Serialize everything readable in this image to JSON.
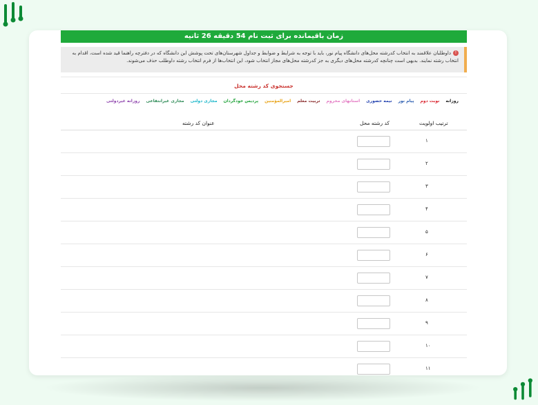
{
  "timer": {
    "text": "زمان باقیمانده برای ثبت نام 54 دقیقه 26 ثانیه"
  },
  "warning": {
    "text": "داوطلبان علاقمند به انتخاب کدرشته محل‌های دانشگاه پیام نور، باید با توجه به شرایط و ضوابط و جداول شهرستان‌های تحت پوشش این دانشگاه که در دفترچه راهنما قید شده است، اقدام به انتخاب رشته نمایند. بدیهی است چنانچه کدرشته محل‌های دیگری به جز کدرشته محل‌های مجاز انتخاب شود، این انتخاب‌ها از فرم انتخاب رشته داوطلب حذف می‌شوند."
  },
  "search": {
    "title": "جستجوی کد رشته محل"
  },
  "filters": [
    {
      "label": "روزانه",
      "color": "#222222"
    },
    {
      "label": "نوبت دوم",
      "color": "#d9232d"
    },
    {
      "label": "پیام نور",
      "color": "#2a5db0"
    },
    {
      "label": "نیمه حضوری",
      "color": "#1f3fae"
    },
    {
      "label": "استانهای محروم",
      "color": "#e377c2"
    },
    {
      "label": "تربیت معلم",
      "color": "#8a2b2b"
    },
    {
      "label": "امیرالمؤمنین",
      "color": "#e8a317"
    },
    {
      "label": "پردیس خودگردان",
      "color": "#21a33a"
    },
    {
      "label": "مجازی دولتی",
      "color": "#17b5c9"
    },
    {
      "label": "مجازی غیرانتفاعی",
      "color": "#2e8b57"
    },
    {
      "label": "روزانه غیردولتی",
      "color": "#8e44ad"
    }
  ],
  "table": {
    "headers": {
      "priority": "ترتیب اولویت",
      "code": "کد رشته محل",
      "title": "عنوان کد رشته"
    },
    "rows": [
      "۱",
      "۲",
      "۳",
      "۴",
      "۵",
      "۶",
      "۷",
      "۸",
      "۹",
      "۱۰",
      "۱۱"
    ]
  }
}
